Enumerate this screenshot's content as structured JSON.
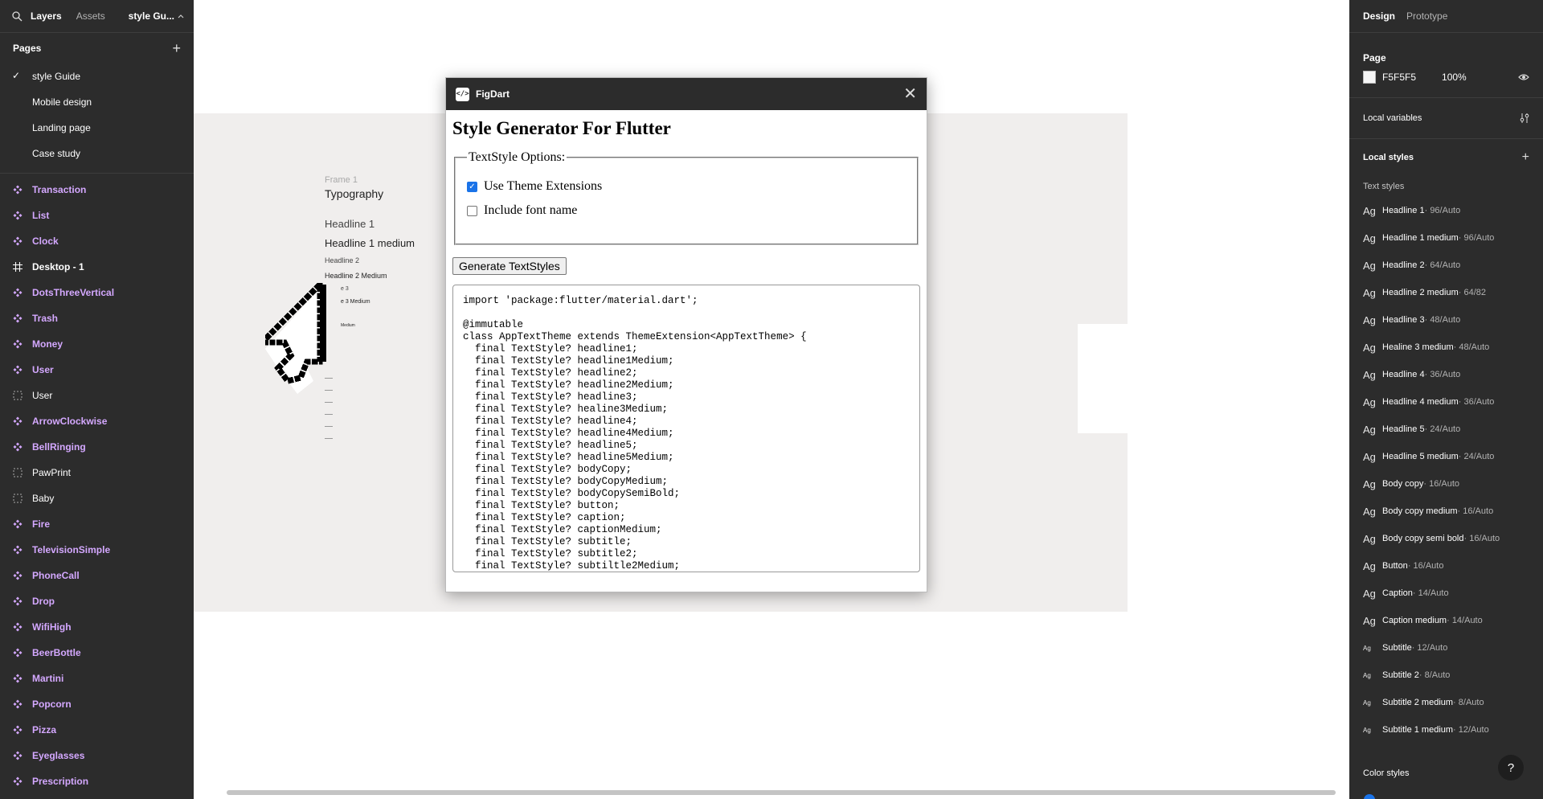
{
  "left_panel": {
    "tabs": {
      "layers": "Layers",
      "assets": "Assets"
    },
    "page_switch": "style Gu...",
    "pages_title": "Pages",
    "pages": [
      {
        "label": "style Guide",
        "selected": true
      },
      {
        "label": "Mobile design",
        "selected": false
      },
      {
        "label": "Landing page",
        "selected": false
      },
      {
        "label": "Case study",
        "selected": false
      }
    ],
    "layers": [
      {
        "label": "Transaction",
        "kind": "component"
      },
      {
        "label": "List",
        "kind": "component"
      },
      {
        "label": "Clock",
        "kind": "component"
      },
      {
        "label": "Desktop - 1",
        "kind": "frame"
      },
      {
        "label": "DotsThreeVertical",
        "kind": "component"
      },
      {
        "label": "Trash",
        "kind": "component"
      },
      {
        "label": "Money",
        "kind": "component"
      },
      {
        "label": "User",
        "kind": "component"
      },
      {
        "label": "User",
        "kind": "instance"
      },
      {
        "label": "ArrowClockwise",
        "kind": "component"
      },
      {
        "label": "BellRinging",
        "kind": "component"
      },
      {
        "label": "PawPrint",
        "kind": "instance"
      },
      {
        "label": "Baby",
        "kind": "instance"
      },
      {
        "label": "Fire",
        "kind": "component"
      },
      {
        "label": "TelevisionSimple",
        "kind": "component"
      },
      {
        "label": "PhoneCall",
        "kind": "component"
      },
      {
        "label": "Drop",
        "kind": "component"
      },
      {
        "label": "WifiHigh",
        "kind": "component"
      },
      {
        "label": "BeerBottle",
        "kind": "component"
      },
      {
        "label": "Martini",
        "kind": "component"
      },
      {
        "label": "Popcorn",
        "kind": "component"
      },
      {
        "label": "Pizza",
        "kind": "component"
      },
      {
        "label": "Eyeglasses",
        "kind": "component"
      },
      {
        "label": "Prescription",
        "kind": "component"
      }
    ]
  },
  "canvas": {
    "frame_label": "Frame 1",
    "typography_title": "Typography",
    "headline1": "Headline 1",
    "headline1_medium": "Headline 1 medium",
    "headline2": "Headline 2",
    "headline2_medium": "Headline 2 Medium",
    "partial_3": "e 3",
    "partial_3_medium": "e 3 Medium",
    "partial_medium": "Medium"
  },
  "plugin": {
    "name": "FigDart",
    "logo_glyph": "</>",
    "close_glyph": "✕",
    "heading": "Style Generator For Flutter",
    "options_legend": "TextStyle Options:",
    "options": [
      {
        "label": "Use Theme Extensions",
        "checked": true
      },
      {
        "label": "Include font name",
        "checked": false
      }
    ],
    "generate_button": "Generate TextStyles",
    "code": "import 'package:flutter/material.dart';\n\n@immutable\nclass AppTextTheme extends ThemeExtension<AppTextTheme> {\n  final TextStyle? headline1;\n  final TextStyle? headline1Medium;\n  final TextStyle? headline2;\n  final TextStyle? headline2Medium;\n  final TextStyle? headline3;\n  final TextStyle? healine3Medium;\n  final TextStyle? headline4;\n  final TextStyle? headline4Medium;\n  final TextStyle? headline5;\n  final TextStyle? headline5Medium;\n  final TextStyle? bodyCopy;\n  final TextStyle? bodyCopyMedium;\n  final TextStyle? bodyCopySemiBold;\n  final TextStyle? button;\n  final TextStyle? caption;\n  final TextStyle? captionMedium;\n  final TextStyle? subtitle;\n  final TextStyle? subtitle2;\n  final TextStyle? subtiltle2Medium;"
  },
  "right_panel": {
    "tabs": {
      "design": "Design",
      "prototype": "Prototype"
    },
    "page_title": "Page",
    "page_color": "F5F5F5",
    "page_opacity": "100%",
    "local_variables": "Local variables",
    "local_styles": "Local styles",
    "text_styles_head": "Text styles",
    "text_styles": [
      {
        "name": "Headline 1",
        "meta": " · 96/Auto",
        "small": false
      },
      {
        "name": "Headline 1 medium",
        "meta": " · 96/Auto",
        "small": false
      },
      {
        "name": "Headline 2",
        "meta": " · 64/Auto",
        "small": false
      },
      {
        "name": "Headline 2 medium",
        "meta": " · 64/82",
        "small": false
      },
      {
        "name": "Headline 3",
        "meta": " · 48/Auto",
        "small": false
      },
      {
        "name": "Healine 3 medium",
        "meta": " · 48/Auto",
        "small": false
      },
      {
        "name": "Headline 4",
        "meta": " · 36/Auto",
        "small": false
      },
      {
        "name": "Headline 4 medium",
        "meta": " · 36/Auto",
        "small": false
      },
      {
        "name": "Headline 5",
        "meta": " · 24/Auto",
        "small": false
      },
      {
        "name": "Headline 5 medium",
        "meta": " · 24/Auto",
        "small": false
      },
      {
        "name": "Body copy",
        "meta": " · 16/Auto",
        "small": false
      },
      {
        "name": "Body copy medium",
        "meta": " · 16/Auto",
        "small": false
      },
      {
        "name": "Body copy semi bold",
        "meta": " · 16/Auto",
        "small": false
      },
      {
        "name": "Button",
        "meta": " · 16/Auto",
        "small": false
      },
      {
        "name": "Caption",
        "meta": " · 14/Auto",
        "small": false
      },
      {
        "name": "Caption medium",
        "meta": " · 14/Auto",
        "small": false
      },
      {
        "name": "Subtitle",
        "meta": " · 12/Auto",
        "small": true
      },
      {
        "name": "Subtitle 2",
        "meta": " · 8/Auto",
        "small": true
      },
      {
        "name": "Subtitle 2 medium",
        "meta": " · 8/Auto",
        "small": true
      },
      {
        "name": "Subtitle 1 medium",
        "meta": " · 12/Auto",
        "small": true
      }
    ],
    "ag_glyph": "Ag",
    "color_styles_head": "Color styles",
    "help_glyph": "?"
  },
  "colors": {
    "panel_bg": "#2c2c2c",
    "component_purple": "#d4a8ff",
    "canvas_frame": "#f0eeed",
    "accent_blue": "#1a73e8"
  }
}
